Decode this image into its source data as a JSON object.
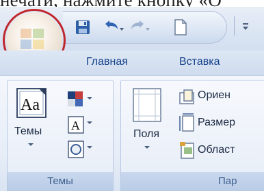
{
  "document": {
    "top_text": "нечати, нажмите кнопку «О"
  },
  "quick_access": {
    "icons": [
      "save-icon",
      "undo-icon",
      "redo-icon",
      "new-document-icon",
      "customize-toolbar-icon"
    ]
  },
  "tabs": [
    {
      "label": "Главная",
      "active": true
    },
    {
      "label": "Вставка",
      "active": false
    }
  ],
  "groups": {
    "themes": {
      "label": "Темы",
      "themes_button": "Темы"
    },
    "page_setup": {
      "label": "Пар",
      "margins_button": "Поля",
      "orientation": "Ориен",
      "size": "Размер",
      "area": "Област"
    }
  },
  "colors": {
    "highlight_ring": "#c0272d",
    "tab_text": "#15428b"
  }
}
